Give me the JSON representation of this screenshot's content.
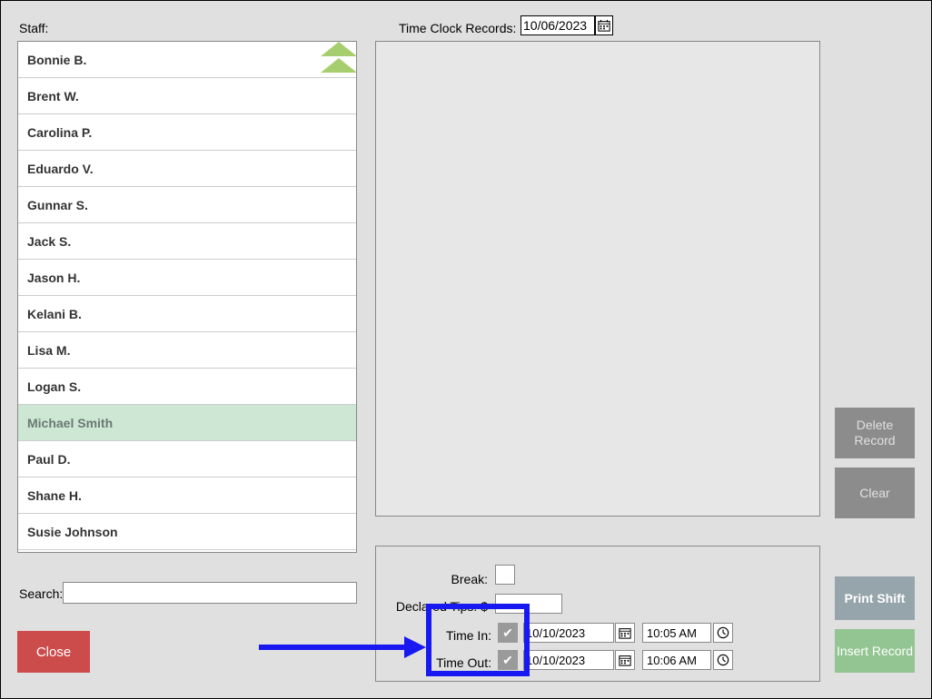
{
  "staff": {
    "label": "Staff:",
    "items": [
      "Bonnie B.",
      "Brent W.",
      "Carolina P.",
      "Eduardo V.",
      "Gunnar S.",
      "Jack S.",
      "Jason H.",
      "Kelani B.",
      "Lisa M.",
      "Logan S.",
      "Michael Smith",
      "Paul D.",
      "Shane H.",
      "Susie Johnson"
    ],
    "selected_index": 10
  },
  "search": {
    "label": "Search:",
    "value": ""
  },
  "close_label": "Close",
  "tcr": {
    "label": "Time Clock Records:",
    "date": "10/06/2023"
  },
  "side_buttons": {
    "delete": "Delete Record",
    "clear": "Clear"
  },
  "bottom": {
    "break_label": "Break:",
    "tips_label": "Declared Tips: $",
    "tips_value": "",
    "time_in_label": "Time In:",
    "time_out_label": "Time Out:",
    "time_in": {
      "checked": true,
      "date": "10/10/2023",
      "time": "10:05 AM"
    },
    "time_out": {
      "checked": true,
      "date": "10/10/2023",
      "time": "10:06 AM"
    }
  },
  "right_buttons": {
    "print": "Print Shift",
    "insert": "Insert Record"
  }
}
